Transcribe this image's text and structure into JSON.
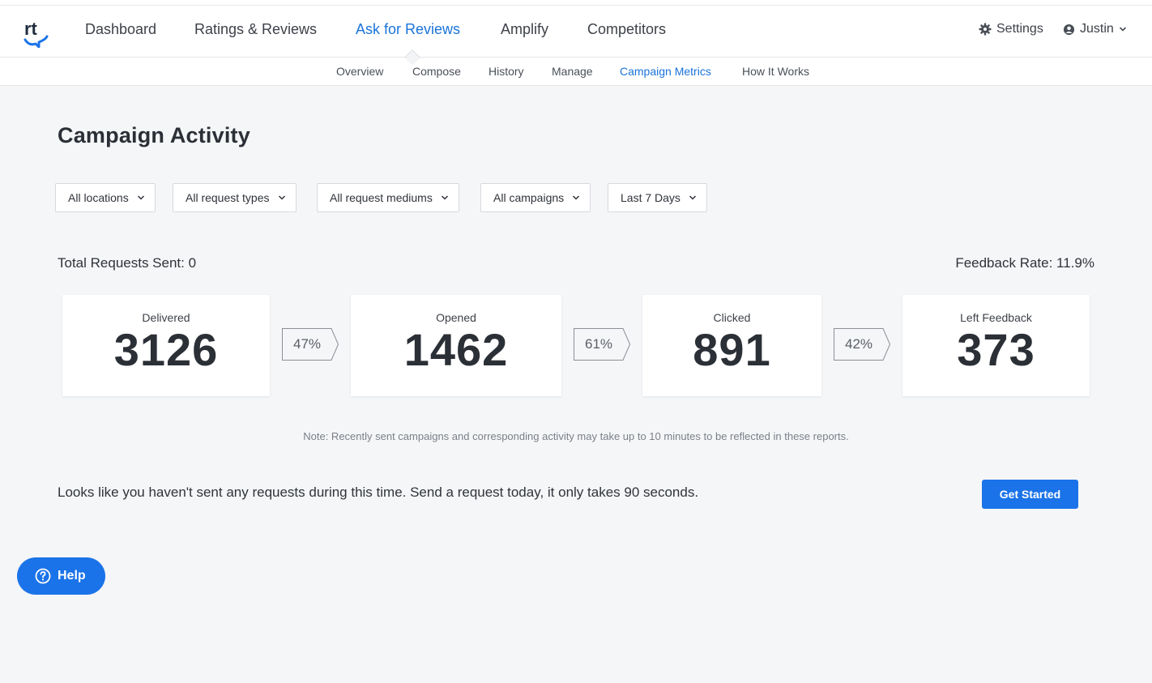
{
  "nav": {
    "items": [
      {
        "label": "Dashboard"
      },
      {
        "label": "Ratings & Reviews"
      },
      {
        "label": "Ask for Reviews"
      },
      {
        "label": "Amplify"
      },
      {
        "label": "Competitors"
      }
    ],
    "active": "Ask for Reviews",
    "settings_label": "Settings",
    "user_label": "Justin"
  },
  "subnav": {
    "items": [
      {
        "label": "Overview"
      },
      {
        "label": "Compose"
      },
      {
        "label": "History"
      },
      {
        "label": "Manage"
      },
      {
        "label": "Campaign Metrics"
      },
      {
        "label": "How It Works"
      }
    ],
    "active": "Campaign Metrics"
  },
  "page": {
    "title": "Campaign Activity"
  },
  "filters": [
    {
      "label": "All locations"
    },
    {
      "label": "All request types"
    },
    {
      "label": "All request mediums"
    },
    {
      "label": "All campaigns"
    },
    {
      "label": "Last 7 Days"
    }
  ],
  "summary": {
    "total_requests": "Total Requests Sent: 0",
    "feedback_rate": "Feedback Rate: 11.9%"
  },
  "funnel": [
    {
      "label": "Delivered",
      "value": "3126"
    },
    {
      "label": "Opened",
      "value": "1462"
    },
    {
      "label": "Clicked",
      "value": "891"
    },
    {
      "label": "Left Feedback",
      "value": "373"
    }
  ],
  "conversion": [
    "47%",
    "61%",
    "42%"
  ],
  "note": "Note: Recently sent campaigns and corresponding activity may take up to 10 minutes to be reflected in these reports.",
  "cta": {
    "text": "Looks like you haven't sent any requests during this time. Send a request today, it only takes 90 seconds.",
    "button": "Get Started"
  },
  "help": {
    "label": "Help"
  },
  "colors": {
    "accent": "#1a73e8",
    "active_link": "#1a73d9",
    "background": "#f5f6f8"
  }
}
